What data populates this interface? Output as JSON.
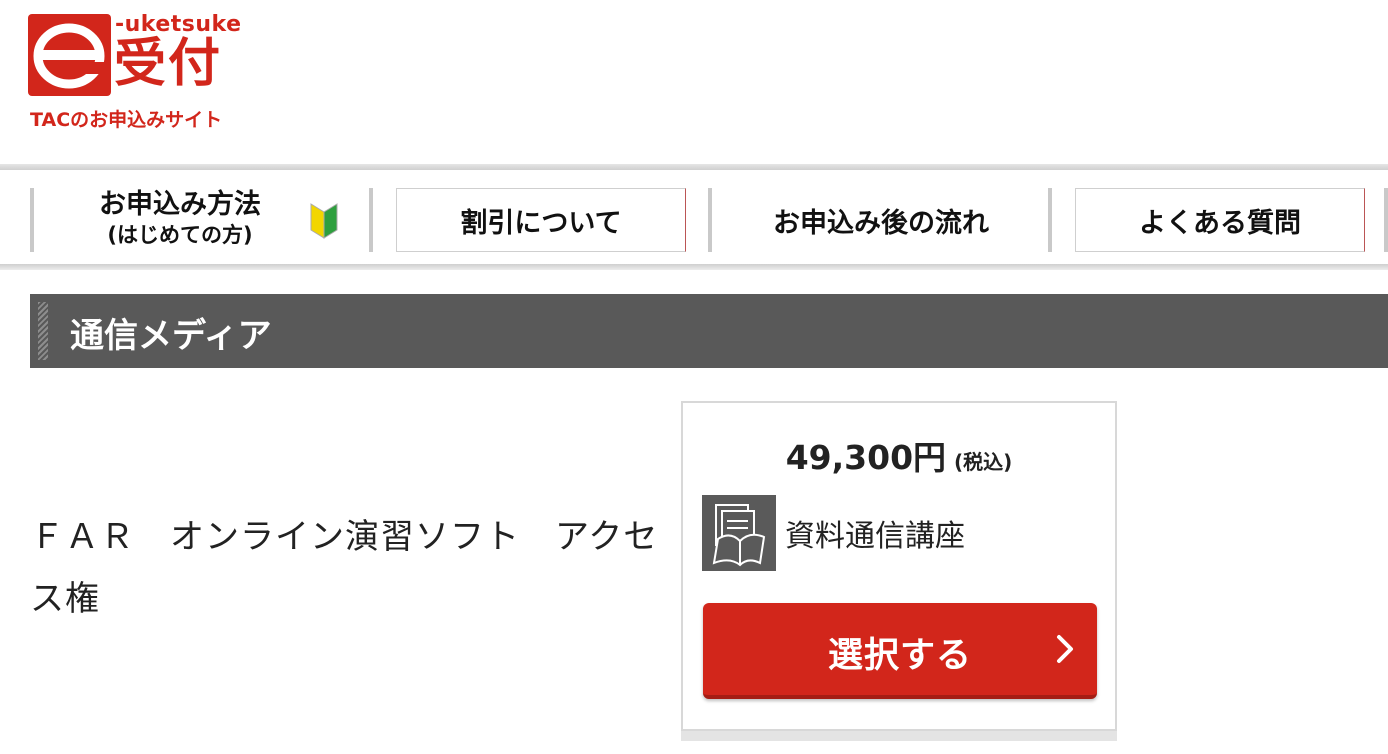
{
  "logo": {
    "letter": "e",
    "romaji": "-uketsuke",
    "kanji": "受付",
    "tagline": "TACのお申込みサイト",
    "brand_color": "#d2261b"
  },
  "nav": {
    "how_to_apply": "お申込み方法",
    "how_to_apply_sub": "(はじめての方)",
    "discount": "割引について",
    "after_apply": "お申込み後の流れ",
    "faq": "よくある質問"
  },
  "section": {
    "title": "通信メディア"
  },
  "product": {
    "name": "ＦＡＲ　オンライン演習ソフト　アクセス権",
    "price": "49,300円",
    "tax_note": "(税込)",
    "media_icon": "document-book-icon",
    "media_label": "資料通信講座",
    "select_button": "選択する",
    "button_color": "#d2261b"
  }
}
